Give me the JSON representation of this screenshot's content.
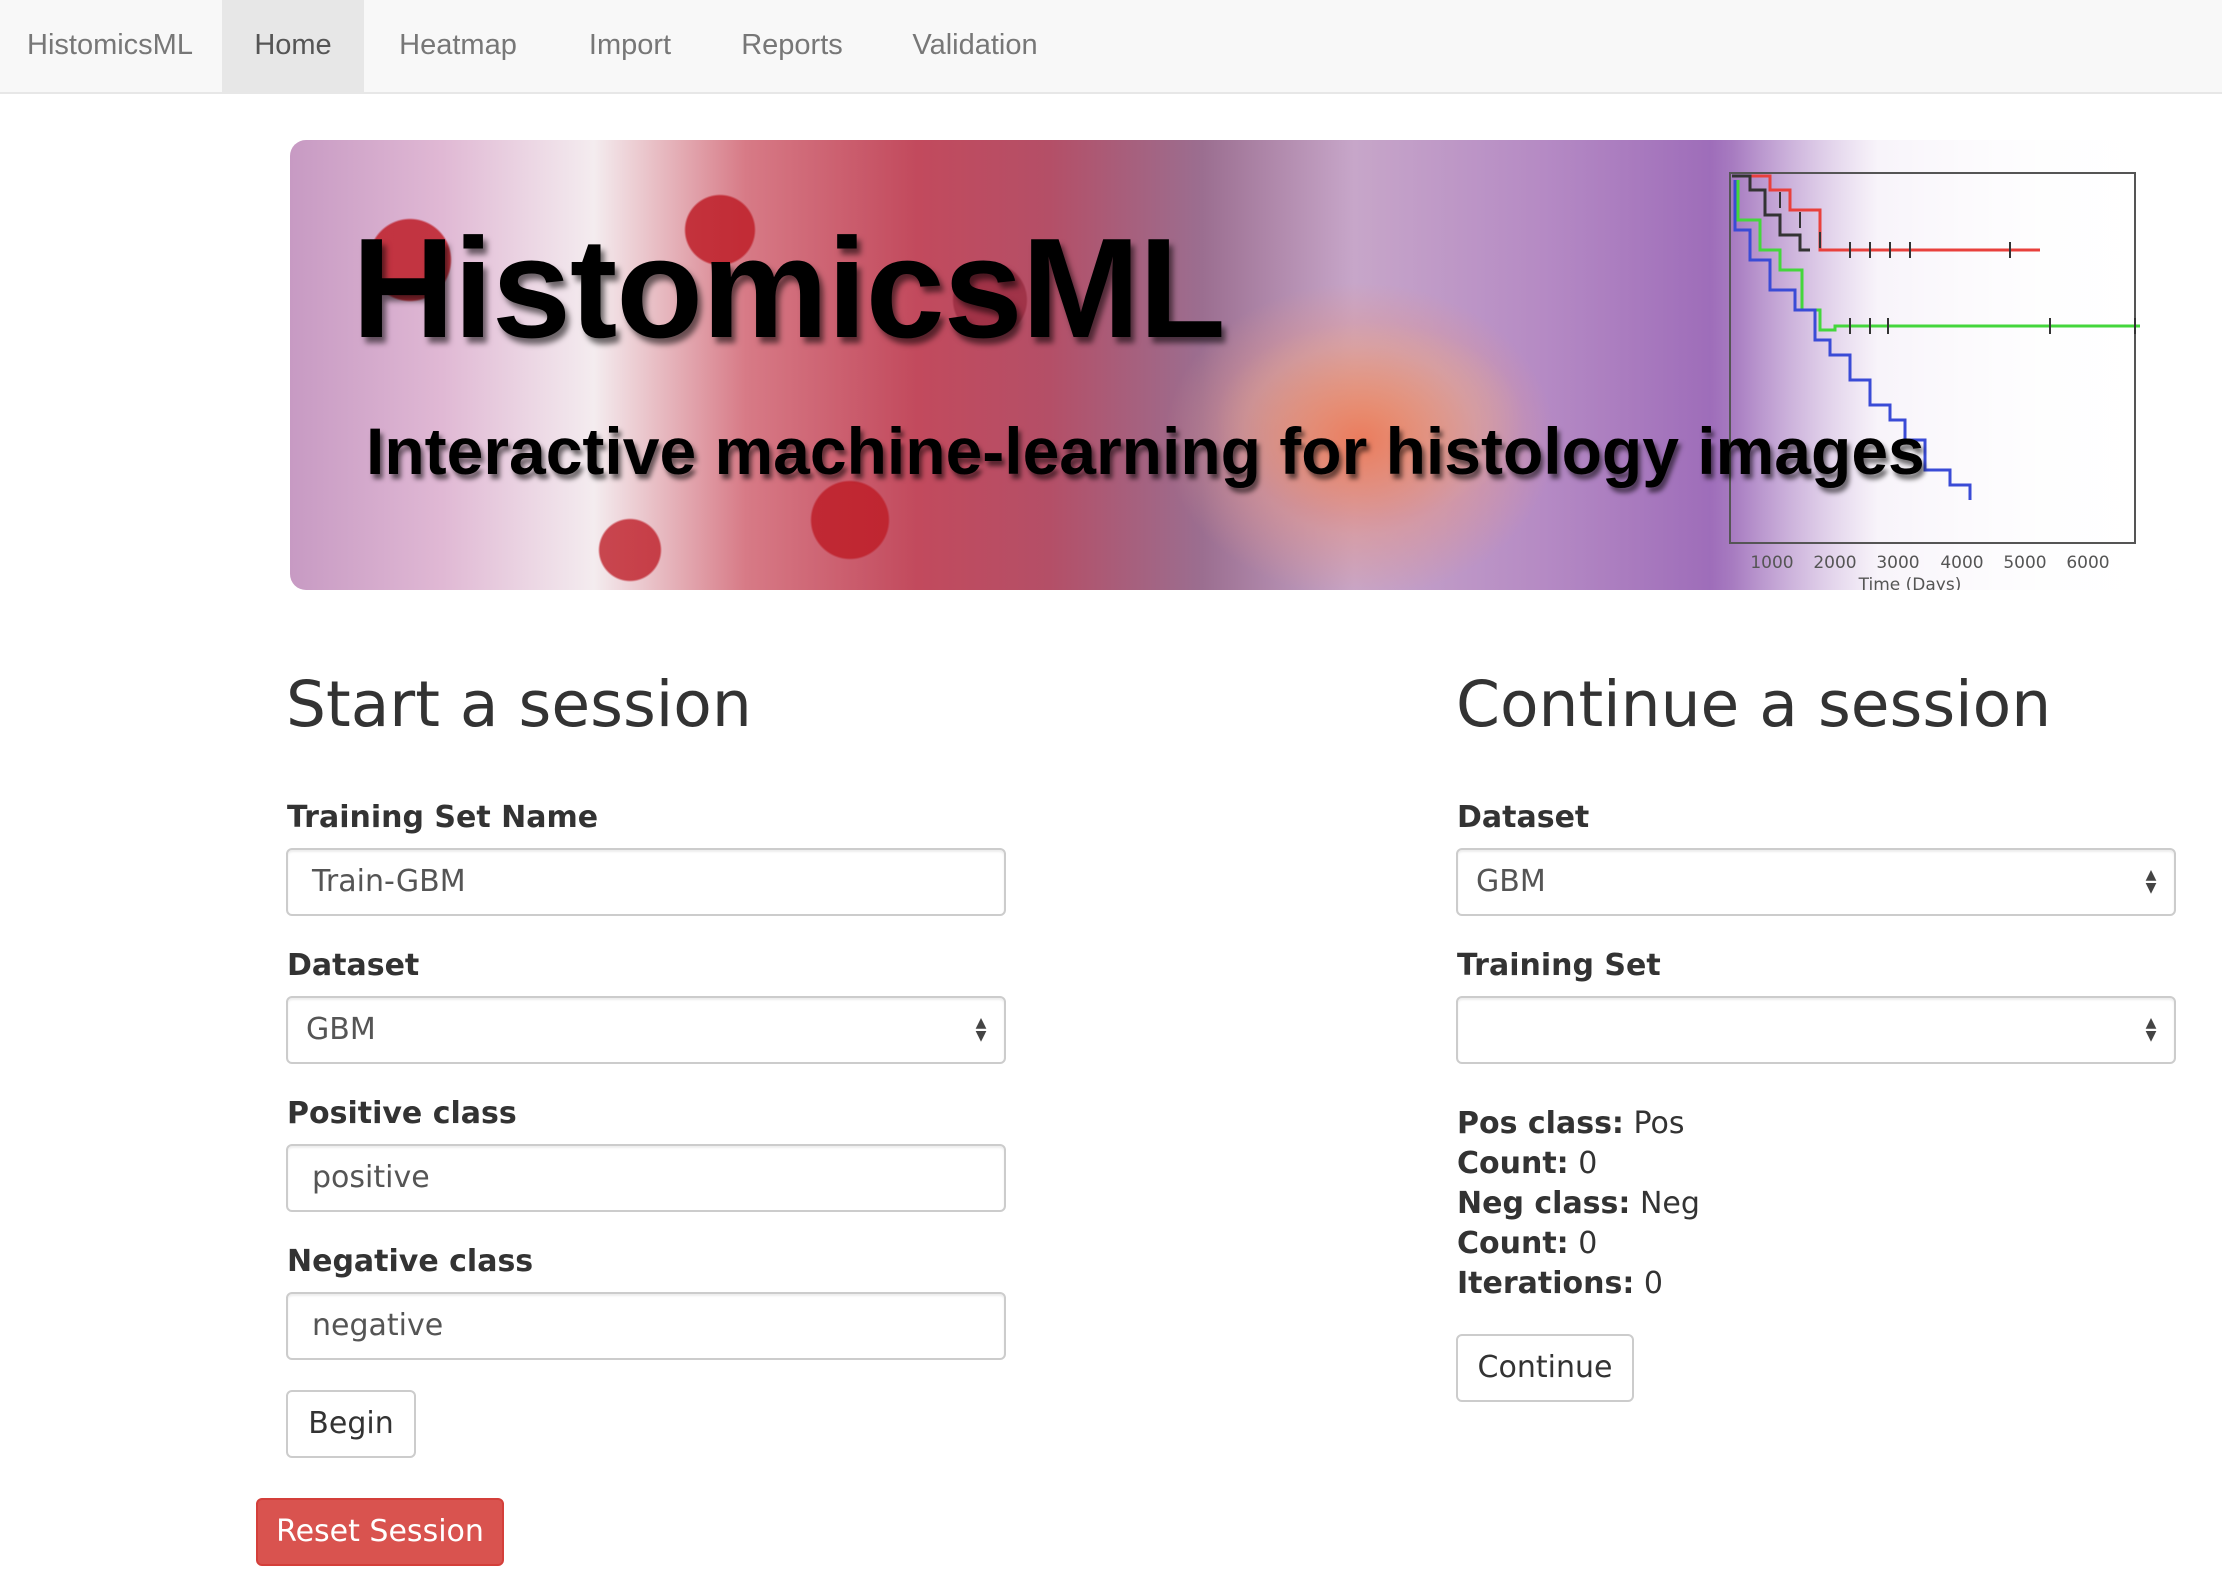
{
  "nav": {
    "brand": "HistomicsML",
    "items": [
      {
        "label": "Home",
        "active": true
      },
      {
        "label": "Heatmap",
        "active": false
      },
      {
        "label": "Import",
        "active": false
      },
      {
        "label": "Reports",
        "active": false
      },
      {
        "label": "Validation",
        "active": false
      }
    ]
  },
  "banner": {
    "title": "HistomicsML",
    "subtitle": "Interactive machine-learning for histology images",
    "plot": {
      "x_ticks": [
        "1000",
        "2000",
        "3000",
        "4000",
        "5000",
        "6000"
      ],
      "x_label": "Time (Days)",
      "series_colors": [
        "#e8403c",
        "#44d63c",
        "#3a4bd6",
        "#333333"
      ]
    }
  },
  "start": {
    "title": "Start a session",
    "training_set_label": "Training Set Name",
    "training_set_value": "Train-GBM",
    "dataset_label": "Dataset",
    "dataset_value": "GBM",
    "positive_label": "Positive class",
    "positive_value": "positive",
    "negative_label": "Negative class",
    "negative_value": "negative",
    "begin_label": "Begin"
  },
  "continue": {
    "title": "Continue a session",
    "dataset_label": "Dataset",
    "dataset_value": "GBM",
    "training_set_label": "Training Set",
    "training_set_value": "",
    "pos_class_key": "Pos class:",
    "pos_class_value": "Pos",
    "pos_count_key": "Count:",
    "pos_count_value": "0",
    "neg_class_key": "Neg class:",
    "neg_class_value": "Neg",
    "neg_count_key": "Count:",
    "neg_count_value": "0",
    "iterations_key": "Iterations:",
    "iterations_value": "0",
    "continue_label": "Continue"
  },
  "reset_label": "Reset Session",
  "colors": {
    "danger": "#d9534f",
    "navbar_bg": "#f8f8f8",
    "nav_active_bg": "#e7e7e7"
  }
}
